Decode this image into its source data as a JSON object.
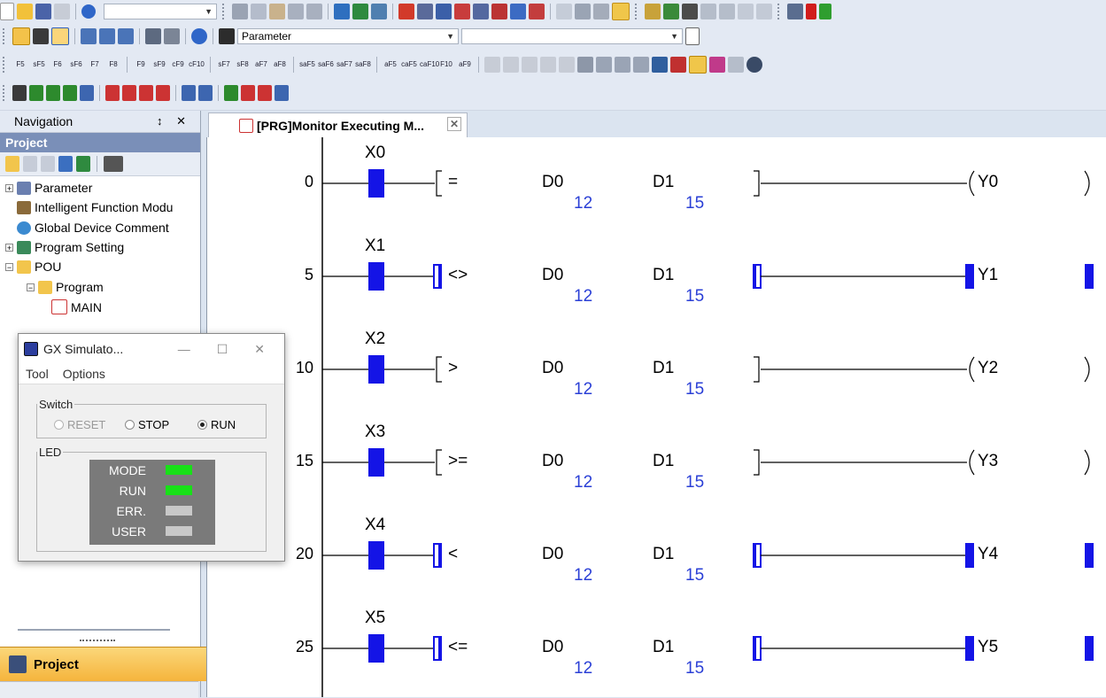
{
  "toolbar": {
    "parameter_combo": "Parameter",
    "fkeys1": [
      "F5",
      "sF5",
      "F6",
      "sF6",
      "F7",
      "F8"
    ],
    "fkeys2": [
      "F9",
      "sF9",
      "cF9",
      "cF10"
    ],
    "fkeys3": [
      "sF7",
      "sF8",
      "aF7",
      "aF8"
    ],
    "fkeys4": [
      "saF5",
      "saF6",
      "saF7",
      "saF8"
    ],
    "fkeys5": [
      "aF5",
      "caF5",
      "caF10",
      "F10",
      "aF9"
    ]
  },
  "navigation": {
    "title": "Navigation",
    "pin_close": "↕ ✕",
    "section": "Project",
    "tree": [
      {
        "label": "Parameter"
      },
      {
        "label": "Intelligent Function Modu"
      },
      {
        "label": "Global Device Comment"
      },
      {
        "label": "Program Setting"
      },
      {
        "label": "POU"
      },
      {
        "label": "Program"
      },
      {
        "label": "MAIN"
      }
    ],
    "footer_button": "Project"
  },
  "tab": {
    "title": "[PRG]Monitor Executing M..."
  },
  "ladder": {
    "rungs": [
      {
        "step": "0",
        "contact": "X0",
        "op": "=",
        "src1": "D0",
        "src2": "D1",
        "val1": "12",
        "val2": "15",
        "coil": "Y0",
        "active": false
      },
      {
        "step": "5",
        "contact": "X1",
        "op": "<>",
        "src1": "D0",
        "src2": "D1",
        "val1": "12",
        "val2": "15",
        "coil": "Y1",
        "active": true
      },
      {
        "step": "10",
        "contact": "X2",
        "op": ">",
        "src1": "D0",
        "src2": "D1",
        "val1": "12",
        "val2": "15",
        "coil": "Y2",
        "active": false
      },
      {
        "step": "15",
        "contact": "X3",
        "op": ">=",
        "src1": "D0",
        "src2": "D1",
        "val1": "12",
        "val2": "15",
        "coil": "Y3",
        "active": false
      },
      {
        "step": "20",
        "contact": "X4",
        "op": "<",
        "src1": "D0",
        "src2": "D1",
        "val1": "12",
        "val2": "15",
        "coil": "Y4",
        "active": true
      },
      {
        "step": "25",
        "contact": "X5",
        "op": "<=",
        "src1": "D0",
        "src2": "D1",
        "val1": "12",
        "val2": "15",
        "coil": "Y5",
        "active": true
      }
    ],
    "active_color": "#1414e6"
  },
  "simulator": {
    "title": "GX Simulato...",
    "menu": {
      "tool": "Tool",
      "options": "Options"
    },
    "switch_label": "Switch",
    "switch_options": {
      "reset": "RESET",
      "stop": "STOP",
      "run": "RUN"
    },
    "switch_selected": "RUN",
    "led_label": "LED",
    "leds": [
      {
        "name": "MODE",
        "color": "#18e018"
      },
      {
        "name": "RUN",
        "color": "#18e018"
      },
      {
        "name": "ERR.",
        "color": "#c8c8c8"
      },
      {
        "name": "USER",
        "color": "#c8c8c8"
      }
    ]
  }
}
